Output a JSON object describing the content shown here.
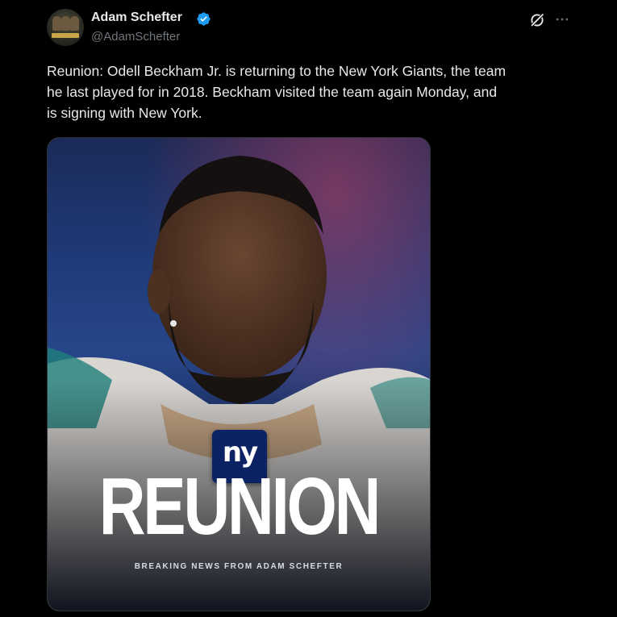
{
  "author": {
    "display_name": "Adam Schefter",
    "handle": "@AdamSchefter",
    "verified_icon": "verified-badge-icon",
    "verified_color": "#1d9bf0"
  },
  "actions": {
    "grok_icon": "grok-icon",
    "more_icon": "more-options-icon"
  },
  "tweet": {
    "text": "Reunion: Odell Beckham Jr. is returning to the New York Giants, the team\nhe last played for in 2018. Beckham visited the team again Monday, and\nis signing with New York."
  },
  "media": {
    "logo_text": "ny",
    "headline": "REUNION",
    "caption": "BREAKING NEWS FROM ADAM SCHEFTER",
    "brand_blue": "#0b2265",
    "brand_red": "#a71930"
  }
}
